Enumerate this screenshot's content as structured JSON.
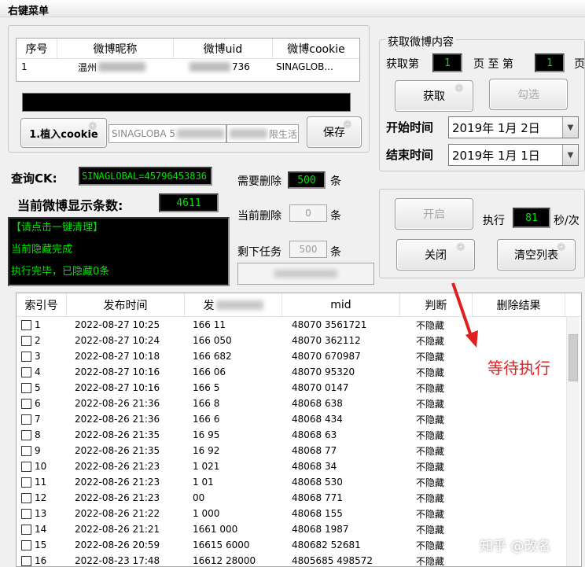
{
  "menu": {
    "title": "右键菜单"
  },
  "top_table": {
    "headers": [
      "序号",
      "微博昵称",
      "微博uid",
      "微博cookie"
    ],
    "row": [
      "1",
      "温州",
      "736",
      "SINAGLOB..."
    ]
  },
  "cookie_area": {
    "plant_button": "1.植入cookie",
    "cookie_field": "SINAGLOBA 5",
    "extra_field": "限生活",
    "save_button": "保存"
  },
  "fetch_group": {
    "title": "获取微博内容",
    "page_prefix": "获取第",
    "page_from": "1",
    "page_mid": "页 至 第",
    "page_to": "1",
    "page_suffix": "页",
    "fetch_button": "获取",
    "select_button": "勾选",
    "start_label": "开始时间",
    "start_date": "2019年  1月  2日",
    "end_label": "结束时间",
    "end_date": "2019年  1月  1日"
  },
  "query": {
    "ck_label": "查询CK:",
    "ck_value": "SINAGLOBAL=45796453836",
    "count_label": "当前微博显示条数:",
    "count_value": "4611"
  },
  "console_lines": [
    "【请点击一键清理】",
    "当前隐藏完成",
    "执行完毕，已隐藏0条"
  ],
  "delete_stats": {
    "need_label": "需要删除",
    "need_value": "500",
    "current_label": "当前删除",
    "current_value": "0",
    "remain_label": "剩下任务",
    "remain_value": "500",
    "unit": "条"
  },
  "control_group": {
    "start_button": "开启",
    "interval_label": "执行",
    "interval_value": "81",
    "interval_unit": "秒/次",
    "close_button": "关闭",
    "clear_button": "清空列表"
  },
  "list": {
    "headers": [
      "索引号",
      "发布时间",
      "发",
      "mid",
      "判断",
      "删除结果"
    ],
    "rows": [
      {
        "idx": "1",
        "time": "2022-08-27 10:25",
        "uid": "166  11",
        "mid": "48070  3561721",
        "judge": "不隐藏"
      },
      {
        "idx": "2",
        "time": "2022-08-27 10:24",
        "uid": "166  050",
        "mid": "48070  362112",
        "judge": "不隐藏"
      },
      {
        "idx": "3",
        "time": "2022-08-27 10:18",
        "uid": "166  682",
        "mid": "48070  670987",
        "judge": "不隐藏"
      },
      {
        "idx": "4",
        "time": "2022-08-27 10:16",
        "uid": "166  06",
        "mid": "48070  95320",
        "judge": "不隐藏"
      },
      {
        "idx": "5",
        "time": "2022-08-27 10:16",
        "uid": "166  5",
        "mid": "48070  0147",
        "judge": "不隐藏"
      },
      {
        "idx": "6",
        "time": "2022-08-26 21:36",
        "uid": "166  8",
        "mid": "48068  638",
        "judge": "不隐藏"
      },
      {
        "idx": "7",
        "time": "2022-08-26 21:36",
        "uid": "166  6",
        "mid": "48068  434",
        "judge": "不隐藏"
      },
      {
        "idx": "8",
        "time": "2022-08-26 21:35",
        "uid": "16  95",
        "mid": "48068  63",
        "judge": "不隐藏"
      },
      {
        "idx": "9",
        "time": "2022-08-26 21:35",
        "uid": "16  92",
        "mid": "48068  77",
        "judge": "不隐藏"
      },
      {
        "idx": "10",
        "time": "2022-08-26 21:23",
        "uid": "1  021",
        "mid": "48068  34",
        "judge": "不隐藏"
      },
      {
        "idx": "11",
        "time": "2022-08-26 21:23",
        "uid": "1  01",
        "mid": "48068  530",
        "judge": "不隐藏"
      },
      {
        "idx": "12",
        "time": "2022-08-26 21:23",
        "uid": "  00",
        "mid": "48068  771",
        "judge": "不隐藏"
      },
      {
        "idx": "13",
        "time": "2022-08-26 21:22",
        "uid": "1  000",
        "mid": "48068  155",
        "judge": "不隐藏"
      },
      {
        "idx": "14",
        "time": "2022-08-26 21:21",
        "uid": "1661  000",
        "mid": "48068  1987",
        "judge": "不隐藏"
      },
      {
        "idx": "15",
        "time": "2022-08-26 20:59",
        "uid": "16615  6000",
        "mid": "480682  52681",
        "judge": "不隐藏"
      },
      {
        "idx": "16",
        "time": "2022-08-23 17:48",
        "uid": "16612  28000",
        "mid": "4805685  498572",
        "judge": "不隐藏"
      }
    ]
  },
  "annotation": "等待执行",
  "watermark": "知乎 @改名"
}
